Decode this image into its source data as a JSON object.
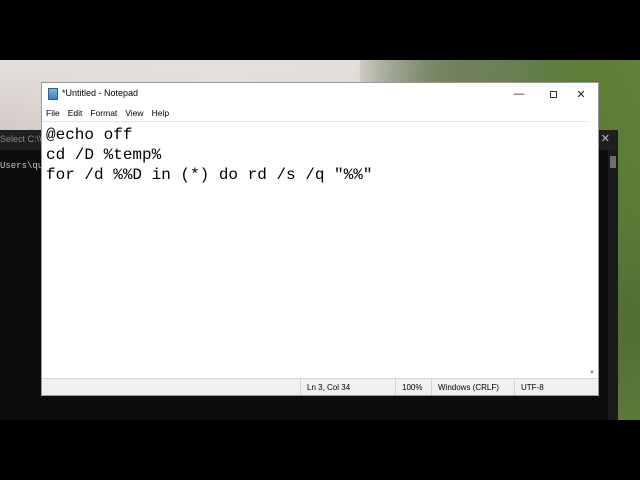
{
  "console": {
    "title": "Select C:\\W",
    "close_glyph": "✕",
    "prompt_fragment": "Users\\quy"
  },
  "notepad": {
    "title": "*Untitled - Notepad",
    "controls": {
      "minimize": "—",
      "close": "✕"
    },
    "menu": [
      "File",
      "Edit",
      "Format",
      "View",
      "Help"
    ],
    "content_lines": [
      "@echo off",
      "cd /D %temp%",
      "for /d %%D in (*) do rd /s /q \"%%\""
    ],
    "status": {
      "position": "Ln 3, Col 34",
      "zoom": "100%",
      "line_ending": "Windows (CRLF)",
      "encoding": "UTF-8"
    }
  },
  "icons": {
    "app_icon": "notepad-icon",
    "minimize": "minimize-icon",
    "maximize": "maximize-icon",
    "close": "close-icon"
  }
}
